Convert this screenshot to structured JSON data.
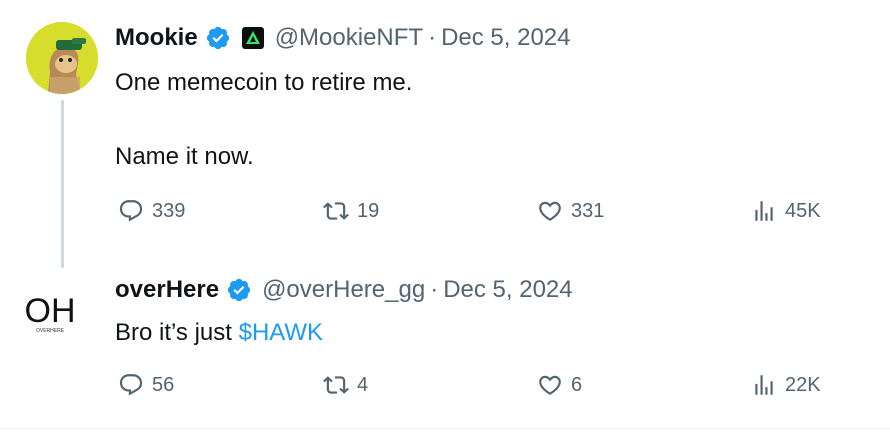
{
  "tweets": [
    {
      "author_name": "Mookie",
      "handle": "@MookieNFT",
      "separator": "·",
      "date": "Dec 5, 2024",
      "avatar_icon": "ape-nft-avatar",
      "affiliation_icon": "green-triangle-badge-icon",
      "text_lines": [
        "One memecoin to retire me.",
        "Name it now."
      ],
      "stats": {
        "replies": "339",
        "retweets": "19",
        "likes": "331",
        "views": "45K"
      }
    },
    {
      "author_name": "overHere",
      "handle": "@overHere_gg",
      "separator": "·",
      "date": "Dec 5, 2024",
      "avatar_icon": "overhere-logo",
      "avatar_text": "OH",
      "avatar_subtext": "OVERHERE",
      "text_prefix": "Bro it’s just ",
      "cashtag": "$HAWK",
      "stats": {
        "replies": "56",
        "retweets": "4",
        "likes": "6",
        "views": "22K"
      }
    }
  ],
  "colors": {
    "verified": "#1d9bf0",
    "muted": "#536471",
    "link": "#1d9bf0",
    "text": "#0f1419"
  }
}
